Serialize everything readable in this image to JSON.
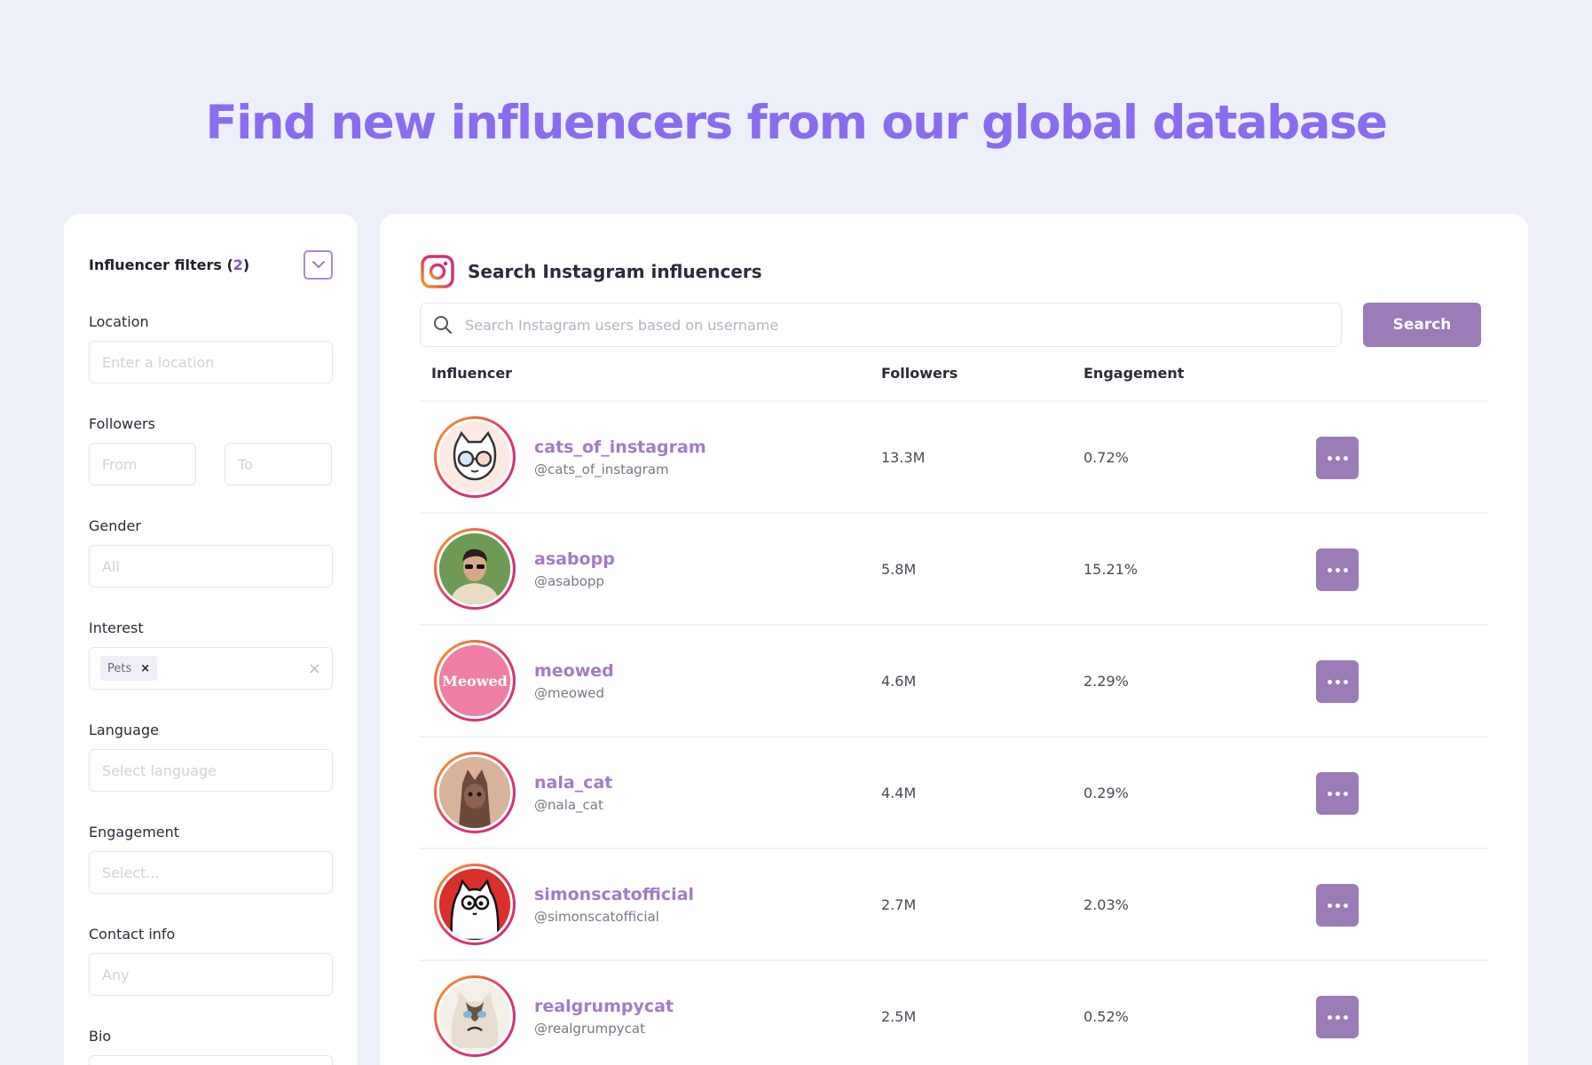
{
  "hero": {
    "title": "Find new influencers from our global database"
  },
  "filters": {
    "title": "Influencer filters",
    "count_open": "(",
    "count": "2",
    "count_close": ")",
    "location": {
      "label": "Location",
      "placeholder": "Enter a location"
    },
    "followers": {
      "label": "Followers",
      "from_placeholder": "From",
      "to_placeholder": "To"
    },
    "gender": {
      "label": "Gender",
      "placeholder": "All"
    },
    "interest": {
      "label": "Interest",
      "chip": "Pets",
      "chip_remove": "×",
      "clear": "×"
    },
    "language": {
      "label": "Language",
      "placeholder": "Select language"
    },
    "engagement": {
      "label": "Engagement",
      "placeholder": "Select..."
    },
    "contact": {
      "label": "Contact info",
      "placeholder": "Any"
    },
    "bio": {
      "label": "Bio"
    }
  },
  "panel": {
    "title": "Search Instagram influencers",
    "icon": "instagram-icon",
    "search_placeholder": "Search Instagram users based on username",
    "search_button": "Search",
    "columns": {
      "influencer": "Influencer",
      "followers": "Followers",
      "engagement": "Engagement"
    }
  },
  "influencers": [
    {
      "name": "cats_of_instagram",
      "handle": "@cats_of_instagram",
      "followers": "13.3M",
      "engagement": "0.72%"
    },
    {
      "name": "asabopp",
      "handle": "@asabopp",
      "followers": "5.8M",
      "engagement": "15.21%"
    },
    {
      "name": "meowed",
      "handle": "@meowed",
      "followers": "4.6M",
      "engagement": "2.29%",
      "avatar_text": "Meowed"
    },
    {
      "name": "nala_cat",
      "handle": "@nala_cat",
      "followers": "4.4M",
      "engagement": "0.29%"
    },
    {
      "name": "simonscatofficial",
      "handle": "@simonscatofficial",
      "followers": "2.7M",
      "engagement": "2.03%"
    },
    {
      "name": "realgrumpycat",
      "handle": "@realgrumpycat",
      "followers": "2.5M",
      "engagement": "0.52%"
    }
  ],
  "colors": {
    "background": "#edf0f8",
    "hero": "#8a6cf0",
    "accent": "#9b7bb8",
    "link": "#a27cc0"
  }
}
